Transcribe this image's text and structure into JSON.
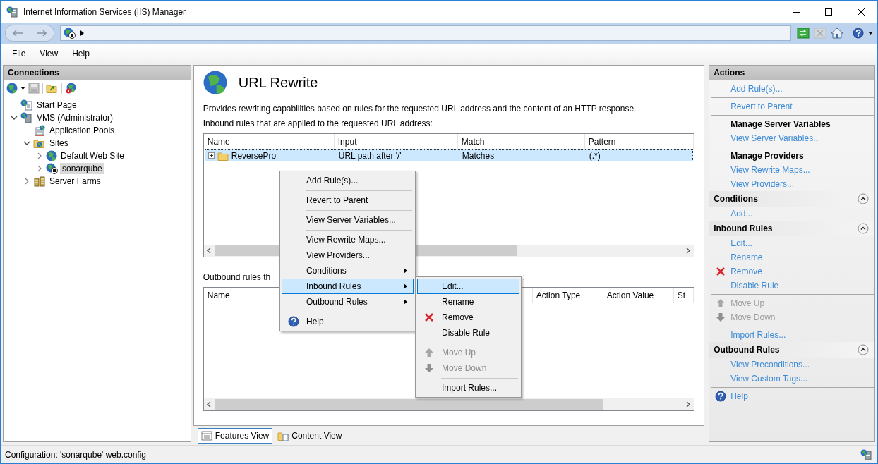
{
  "window": {
    "title": "Internet Information Services (IIS) Manager"
  },
  "menu_bar": [
    "File",
    "View",
    "Help"
  ],
  "connections": {
    "title": "Connections",
    "tree": [
      {
        "label": "Start Page",
        "kind": "start_page",
        "selected": false
      },
      {
        "label": "VMS (Administrator)",
        "kind": "server",
        "selected": false,
        "expanded": true,
        "children": [
          {
            "label": "Application Pools",
            "kind": "app_pools",
            "selected": false
          },
          {
            "label": "Sites",
            "kind": "sites",
            "selected": false,
            "expanded": true,
            "children": [
              {
                "label": "Default Web Site",
                "kind": "site",
                "selected": false,
                "expanded": false
              },
              {
                "label": "sonarqube",
                "kind": "site_stopped",
                "selected": true,
                "expanded": false
              }
            ]
          },
          {
            "label": "Server Farms",
            "kind": "server_farms",
            "selected": false,
            "expanded": false
          }
        ]
      }
    ]
  },
  "feature": {
    "title": "URL Rewrite",
    "description": "Provides rewriting capabilities based on rules for the requested URL address and the content of an HTTP response.",
    "inbound_label": "Inbound rules that are applied to the requested URL address:",
    "inbound": {
      "columns": [
        "Name",
        "Input",
        "Match",
        "Pattern"
      ],
      "rows": [
        {
          "cells": [
            "ReversePro",
            "URL path after '/'",
            "Matches",
            "(.*)"
          ],
          "selected": true
        }
      ]
    },
    "outbound_label": "Outbound rules th",
    "outbound_label_tail": ":",
    "outbound": {
      "columns": [
        "Name",
        "Action Type",
        "Action Value",
        "St"
      ]
    }
  },
  "view_tabs": [
    {
      "label": "Features View",
      "selected": true
    },
    {
      "label": "Content View",
      "selected": false
    }
  ],
  "context_menu": {
    "items": [
      {
        "kind": "item",
        "label": "Add Rule(s)...",
        "selected": false,
        "submenu": false
      },
      {
        "kind": "separator"
      },
      {
        "kind": "item",
        "label": "Revert to Parent",
        "selected": false,
        "submenu": false
      },
      {
        "kind": "separator"
      },
      {
        "kind": "item",
        "label": "View Server Variables...",
        "selected": false,
        "submenu": false
      },
      {
        "kind": "separator"
      },
      {
        "kind": "item",
        "label": "View Rewrite Maps...",
        "selected": false,
        "submenu": false
      },
      {
        "kind": "item",
        "label": "View Providers...",
        "selected": false,
        "submenu": false
      },
      {
        "kind": "item",
        "label": "Conditions",
        "selected": false,
        "submenu": true
      },
      {
        "kind": "item",
        "label": "Inbound Rules",
        "selected": true,
        "submenu": true
      },
      {
        "kind": "item",
        "label": "Outbound Rules",
        "selected": false,
        "submenu": true
      },
      {
        "kind": "separator"
      },
      {
        "kind": "help",
        "label": "Help",
        "selected": false,
        "submenu": false
      }
    ]
  },
  "submenu": {
    "items": [
      {
        "kind": "item",
        "label": "Edit...",
        "selected": true,
        "disabled": false
      },
      {
        "kind": "item",
        "label": "Rename",
        "selected": false,
        "disabled": false
      },
      {
        "kind": "remove",
        "label": "Remove",
        "selected": false,
        "disabled": false
      },
      {
        "kind": "item",
        "label": "Disable Rule",
        "selected": false,
        "disabled": false
      },
      {
        "kind": "separator"
      },
      {
        "kind": "move_up",
        "label": "Move Up",
        "selected": false,
        "disabled": true
      },
      {
        "kind": "move_down",
        "label": "Move Down",
        "selected": false,
        "disabled": true
      },
      {
        "kind": "separator"
      },
      {
        "kind": "item",
        "label": "Import Rules...",
        "selected": false,
        "disabled": false
      }
    ]
  },
  "actions": {
    "title": "Actions",
    "items": [
      {
        "kind": "link",
        "label": "Add Rule(s)...",
        "disabled": false
      },
      {
        "kind": "separator"
      },
      {
        "kind": "link",
        "label": "Revert to Parent",
        "disabled": false
      },
      {
        "kind": "separator"
      },
      {
        "kind": "heading",
        "label": "Manage Server Variables"
      },
      {
        "kind": "link",
        "label": "View Server Variables...",
        "disabled": false
      },
      {
        "kind": "separator"
      },
      {
        "kind": "heading",
        "label": "Manage Providers"
      },
      {
        "kind": "link",
        "label": "View Rewrite Maps...",
        "disabled": false
      },
      {
        "kind": "link",
        "label": "View Providers...",
        "disabled": false
      },
      {
        "kind": "section",
        "label": "Conditions",
        "expanded": true
      },
      {
        "kind": "link",
        "label": "Add...",
        "disabled": false
      },
      {
        "kind": "section",
        "label": "Inbound Rules",
        "expanded": true
      },
      {
        "kind": "link",
        "label": "Edit...",
        "disabled": false
      },
      {
        "kind": "link",
        "label": "Rename",
        "disabled": false
      },
      {
        "kind": "remove",
        "label": "Remove",
        "disabled": false
      },
      {
        "kind": "link",
        "label": "Disable Rule",
        "disabled": false
      },
      {
        "kind": "separator"
      },
      {
        "kind": "move_up",
        "label": "Move Up",
        "disabled": true
      },
      {
        "kind": "move_down",
        "label": "Move Down",
        "disabled": true
      },
      {
        "kind": "separator"
      },
      {
        "kind": "link",
        "label": "Import Rules...",
        "disabled": false
      },
      {
        "kind": "section",
        "label": "Outbound Rules",
        "expanded": true
      },
      {
        "kind": "link",
        "label": "View Preconditions...",
        "disabled": false
      },
      {
        "kind": "link",
        "label": "View Custom Tags...",
        "disabled": false
      },
      {
        "kind": "separator"
      },
      {
        "kind": "help",
        "label": "Help",
        "disabled": false
      }
    ]
  },
  "status_bar": {
    "text": "Configuration: 'sonarqube' web.config"
  }
}
